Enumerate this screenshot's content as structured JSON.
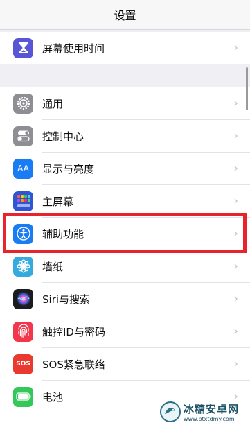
{
  "nav": {
    "title": "设置"
  },
  "chevron": "›",
  "rows": [
    {
      "label": "屏幕使用时间",
      "icon": "hourglass-icon",
      "color": "#5856d6"
    },
    {
      "label": "通用",
      "icon": "gear-icon",
      "color": "#8e8e93"
    },
    {
      "label": "控制中心",
      "icon": "toggles-icon",
      "color": "#8e8e93"
    },
    {
      "label": "显示与亮度",
      "icon": "text-size-icon",
      "color": "#1a7cf3",
      "icon_text": "AA"
    },
    {
      "label": "主屏幕",
      "icon": "app-grid-icon",
      "color": "#2f55d4"
    },
    {
      "label": "辅助功能",
      "icon": "accessibility-icon",
      "color": "#1a7cf3"
    },
    {
      "label": "墙纸",
      "icon": "flower-icon",
      "color": "#35aadc"
    },
    {
      "label": "Siri与搜索",
      "icon": "siri-icon",
      "color": "#1c1c1e"
    },
    {
      "label": "触控ID与密码",
      "icon": "fingerprint-icon",
      "color": "#f2364b"
    },
    {
      "label": "SOS紧急联络",
      "icon": "sos-icon",
      "color": "#ea3a2f",
      "icon_text": "SOS"
    },
    {
      "label": "电池",
      "icon": "battery-icon",
      "color": "#34c759"
    }
  ],
  "colors": {
    "highlight": "#e8232c",
    "background": "#efeff4"
  },
  "watermark": {
    "name": "冰糖安卓网",
    "url": "www.btxtdmy.com"
  }
}
